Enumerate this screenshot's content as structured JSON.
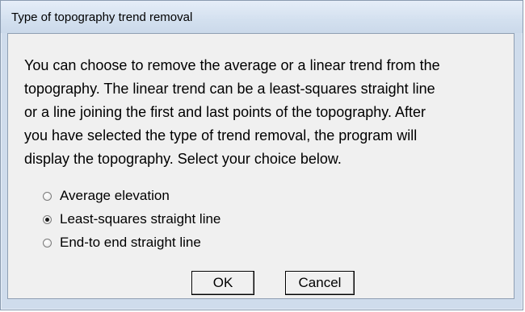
{
  "dialog": {
    "title": "Type of topography trend removal",
    "message_lines": [
      "You can choose to remove the average or a linear trend from the",
      "topography. The linear trend can be a least-squares straight line",
      "or a line joining the first and last points of the topography. After",
      "you have selected the type of trend removal, the program will",
      "display the topography. Select your choice below."
    ],
    "options": [
      {
        "label": "Average elevation",
        "selected": false
      },
      {
        "label": "Least-squares straight line",
        "selected": true
      },
      {
        "label": "End-to end straight line",
        "selected": false
      }
    ],
    "ok_label": "OK",
    "cancel_label": "Cancel"
  }
}
